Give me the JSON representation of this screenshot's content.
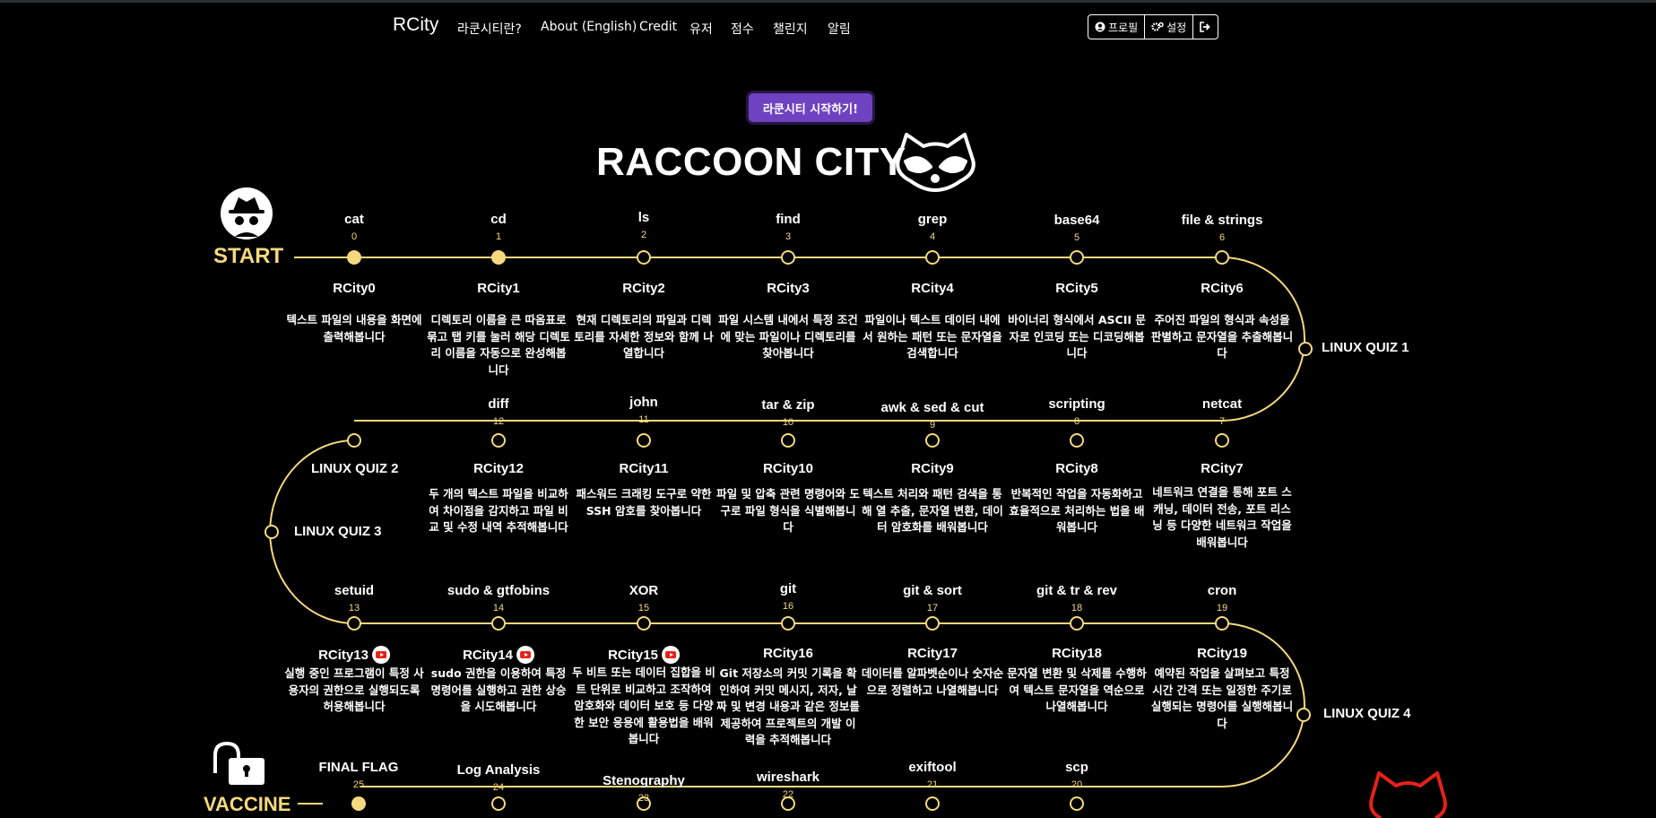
{
  "nav": {
    "brand": "RCity",
    "links": [
      "라쿤시티란?",
      "About (English)",
      "Credit",
      "유저",
      "점수",
      "챌린지",
      "알림"
    ],
    "profile": "프로필",
    "settings": "설정"
  },
  "start_button": "라쿤시티 시작하기!",
  "title": "RACCOON CITY",
  "start_label": "START",
  "vaccine_label": "VACCINE",
  "colors": {
    "gold": "#f5d97e",
    "purple": "#6f42c1",
    "red": "#e62117"
  },
  "stages": [
    {
      "cmd": "cat",
      "num": "0",
      "rc": "RCity0",
      "desc": "텍스트 파일의 내용을 화면에 출력해봅니다",
      "done": true
    },
    {
      "cmd": "cd",
      "num": "1",
      "rc": "RCity1",
      "desc": "디렉토리 이름을 큰 따옴표로 묶고 탭 키를 눌러 해당 디렉토리 이름을 자동으로 완성해봅니다",
      "done": true
    },
    {
      "cmd": "ls",
      "num": "2",
      "rc": "RCity2",
      "desc": "현재 디렉토리의 파일과 디렉토리를 자세한 정보와 함께 나열합니다",
      "done": false
    },
    {
      "cmd": "find",
      "num": "3",
      "rc": "RCity3",
      "desc": "파일 시스템 내에서 특정 조건에 맞는 파일이나 디렉토리를 찾아봅니다",
      "done": false
    },
    {
      "cmd": "grep",
      "num": "4",
      "rc": "RCity4",
      "desc": "파일이나 텍스트 데이터 내에서 원하는 패턴 또는 문자열을 검색합니다",
      "done": false
    },
    {
      "cmd": "base64",
      "num": "5",
      "rc": "RCity5",
      "desc": "바이너리 형식에서 ASCII 문자로 인코딩 또는 디코딩해봅니다",
      "done": false
    },
    {
      "cmd": "file & strings",
      "num": "6",
      "rc": "RCity6",
      "desc": "주어진 파일의 형식과 속성을 판별하고 문자열을 추출해봅니다",
      "done": false
    },
    {
      "cmd": "netcat",
      "num": "7",
      "rc": "RCity7",
      "desc": "네트워크 연결을 통해 포트 스캐닝, 데이터 전송, 포트 리스닝 등 다양한 네트워크 작업을 배워봅니다",
      "done": false
    },
    {
      "cmd": "scripting",
      "num": "8",
      "rc": "RCity8",
      "desc": "반복적인 작업을 자동화하고 효율적으로 처리하는 법을 배워봅니다",
      "done": false
    },
    {
      "cmd": "awk & sed & cut",
      "num": "9",
      "rc": "RCity9",
      "desc": "텍스트 처리와 패턴 검색을 통해 열 추출, 문자열 변환, 데이터 암호화를 배워봅니다",
      "done": false
    },
    {
      "cmd": "tar & zip",
      "num": "10",
      "rc": "RCity10",
      "desc": "파일 및 압축 관련 명령어와 도구로 파일 형식을 식별해봅니다",
      "done": false
    },
    {
      "cmd": "john",
      "num": "11",
      "rc": "RCity11",
      "desc": "패스워드 크래킹 도구로 약한 SSH 암호를 찾아봅니다",
      "done": false
    },
    {
      "cmd": "diff",
      "num": "12",
      "rc": "RCity12",
      "desc": "두 개의 텍스트 파일을 비교하여 차이점을 감지하고 파일 비교 및 수정 내역 추적해봅니다",
      "done": false
    },
    {
      "cmd": "setuid",
      "num": "13",
      "rc": "RCity13",
      "desc": "실행 중인 프로그램이 특정 사용자의 권한으로 실행되도록 허용해봅니다",
      "done": false,
      "yt": true
    },
    {
      "cmd": "sudo & gtfobins",
      "num": "14",
      "rc": "RCity14",
      "desc": "sudo 권한을 이용하여 특정 명령어를 실행하고 권한 상승을 시도해봅니다",
      "done": false,
      "yt": true
    },
    {
      "cmd": "XOR",
      "num": "15",
      "rc": "RCity15",
      "desc": "두 비트 또는 데이터 집합을 비트 단위로 비교하고 조작하여 암호화와 데이터 보호 등 다양한 보안 응용에 활용법을 배워봅니다",
      "done": false,
      "yt": true
    },
    {
      "cmd": "git",
      "num": "16",
      "rc": "RCity16",
      "desc": "Git 저장소의 커밋 기록을 확인하여 커밋 메시지, 저자, 날짜 및 변경 내용과 같은 정보를 제공하여 프로젝트의 개발 이력을 추적해봅니다",
      "done": false
    },
    {
      "cmd": "git & sort",
      "num": "17",
      "rc": "RCity17",
      "desc": "데이터를 알파벳순이나 숫자순으로 정렬하고 나열해봅니다",
      "done": false
    },
    {
      "cmd": "git & tr & rev",
      "num": "18",
      "rc": "RCity18",
      "desc": "문자열 변환 및 삭제를 수행하여 텍스트 문자열을 역순으로 나열해봅니다",
      "done": false
    },
    {
      "cmd": "cron",
      "num": "19",
      "rc": "RCity19",
      "desc": "예약된 작업을 살펴보고 특정 시간 간격 또는 일정한 주기로 실행되는 명령어를 실행해봅니다",
      "done": false
    },
    {
      "cmd": "scp",
      "num": "20",
      "done": false
    },
    {
      "cmd": "exiftool",
      "num": "21",
      "done": false
    },
    {
      "cmd": "wireshark",
      "num": "22",
      "done": false
    },
    {
      "cmd": "Stenography",
      "num": "23",
      "done": false
    },
    {
      "cmd": "Log Analysis",
      "num": "24",
      "done": false
    },
    {
      "cmd": "FINAL FLAG",
      "num": "25",
      "done": true
    }
  ],
  "quizzes": [
    "LINUX QUIZ 1",
    "LINUX QUIZ 2",
    "LINUX QUIZ 3",
    "LINUX QUIZ 4"
  ]
}
